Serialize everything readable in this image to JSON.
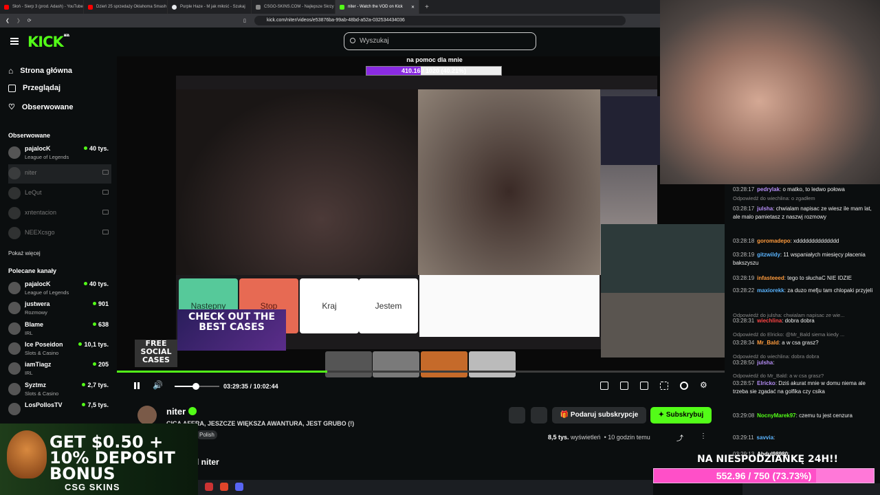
{
  "browser": {
    "tabs": [
      {
        "label": "Słoń - Sierp 3 (prod. Adash) - YouTube",
        "color": "#ff0000"
      },
      {
        "label": "Dzień 25 sprzedaży Oklahoma Smash",
        "color": "#ff0000"
      },
      {
        "label": "Purple Haze - M jak miłość - Szukaj",
        "color": "#e8eaed"
      },
      {
        "label": "CSGO-SKINS.COM - Najlepsze Skrzy",
        "color": "#888888"
      },
      {
        "label": "niter - Watch the VOD on Kick",
        "color": "#53fc18"
      }
    ],
    "url": "kick.com/niter/videos/e53876ba-99ab-48bd-a52a-032534434036"
  },
  "header": {
    "logo": "KICK",
    "logo_badge": "BETA",
    "search_placeholder": "Wyszukaj"
  },
  "sidebar": {
    "nav": [
      "Strona główna",
      "Przeglądaj",
      "Obserwowane"
    ],
    "followed_heading": "Obserwowane",
    "followed": [
      {
        "name": "pajalocK",
        "category": "League of Legends",
        "viewers": "40 tys.",
        "live": true
      },
      {
        "name": "niter",
        "live": false
      },
      {
        "name": "LeQut",
        "live": false
      },
      {
        "name": "xntentacion",
        "live": false
      },
      {
        "name": "NEEXcsgo",
        "live": false
      }
    ],
    "show_more": "Pokaż więcej",
    "recommended_heading": "Polecane kanały",
    "recommended": [
      {
        "name": "pajalocK",
        "category": "League of Legends",
        "viewers": "40 tys."
      },
      {
        "name": "justwera",
        "category": "Rozmowy",
        "viewers": "901"
      },
      {
        "name": "Blame",
        "category": "IRL",
        "viewers": "638"
      },
      {
        "name": "Ice Poseidon",
        "category": "Slots & Casino",
        "viewers": "10,1 tys."
      },
      {
        "name": "iamTiagz",
        "category": "IRL",
        "viewers": "205"
      },
      {
        "name": "Syztmz",
        "category": "Slots & Casino",
        "viewers": "2,7 tys."
      },
      {
        "name": "LosPollosTV",
        "category": "",
        "viewers": "7,5 tys."
      }
    ]
  },
  "video": {
    "overlay_title": "na pomoc dla mnie",
    "overlay_bar_text": "410.16 / 1020 (40.21%)",
    "overlay_bar_progress": 0.4021,
    "buttons": [
      "Następny",
      "Stop",
      "Kraj",
      "Jestem"
    ],
    "ad_text": "CHECK OUT THE BEST CASES",
    "ad2_text": "FREE SOCIAL CASES",
    "seek_progress": 0.346,
    "volume": 0.48,
    "time_current": "03:29:35",
    "time_sep": "/",
    "time_total": "10:02:44"
  },
  "info": {
    "streamer": "niter",
    "title": "CICA AFERA, JESZCZE WIĘKSZA AWANTURA, JEST GRUBO (!)",
    "tag": "Polish",
    "about": "l niter",
    "gift_label": "Podaruj subskrypcje",
    "subscribe_label": "Subskrybuj",
    "views": "8,5 tys.",
    "views_word": "wyświetleń",
    "ago": "10 godzin temu"
  },
  "chat": [
    {
      "time": "03:28:17",
      "user": "pedrylak",
      "color": "#b68ef7",
      "text": "o matko, to ledwo połowa"
    },
    {
      "reply": "Odpowiedź do wiechlina: o zgadłem"
    },
    {
      "time": "03:28:17",
      "user": "julsha",
      "color": "#b68ef7",
      "text": "chwialam napisac ze wiesz ile mam lat, ale malo pamietasz z naszwj rozmowy"
    },
    {
      "time": "03:28:18",
      "user": "goromadepo",
      "color": "#ff9b3d",
      "text": "xdddddddddddddd"
    },
    {
      "time": "03:28:19",
      "user": "gitzwildy",
      "color": "#5ab4ff",
      "text": "11 wspaniałych miesięcy płacenia bakszyszu"
    },
    {
      "time": "03:28:19",
      "user": "infasteeed",
      "color": "#ff9b3d",
      "text": "tego to słuchaC NIE IDZIE"
    },
    {
      "time": "03:28:22",
      "user": "maxiorekk",
      "color": "#5ab4ff",
      "text": "za duzo mefju tam chlopaki przyjeli"
    },
    {
      "reply": "Odpowiedź do julsha: chwialam napisac ze wie..."
    },
    {
      "time": "03:28:31",
      "user": "wiechlina",
      "color": "#ff4444",
      "text": "dobra dobra"
    },
    {
      "reply": "Odpowiedź do Elricko: @Mr_Bald siema kiedy ..."
    },
    {
      "time": "03:28:34",
      "user": "Mr_Bald",
      "color": "#ff9b3d",
      "text": "a w csa grasz?"
    },
    {
      "reply": "Odpowiedź do wiechlina: dobra dobra"
    },
    {
      "time": "03:28:50",
      "user": "julsha",
      "color": "#b68ef7",
      "text": ""
    },
    {
      "reply": "Odpowiedź do Mr_Bald: a w csa grasz?"
    },
    {
      "time": "03:28:57",
      "user": "Elricko",
      "color": "#b68ef7",
      "text": "Dziś akurat mnie w domu niema ale trzeba sie zgadać na golfika czy csika"
    },
    {
      "time": "03:29:08",
      "user": "NocnyMarek97",
      "color": "#53fc18",
      "text": "czemu tu jest cenzura"
    },
    {
      "time": "03:29:11",
      "user": "savvia",
      "color": "#5ab4ff",
      "text": ""
    },
    {
      "time": "03:29:13",
      "user": "Abdul98980",
      "color": "#ffffff",
      "text": ""
    }
  ],
  "banner": {
    "text": "GET $0.50 + 10% DEPOSIT BONUS",
    "brand": "CSG SKINS"
  },
  "goal": {
    "title": "NA NIESPODZIANKĘ 24H!!",
    "bar_text": "552.96 / 750 (73.73%)",
    "progress": 0.7373
  }
}
